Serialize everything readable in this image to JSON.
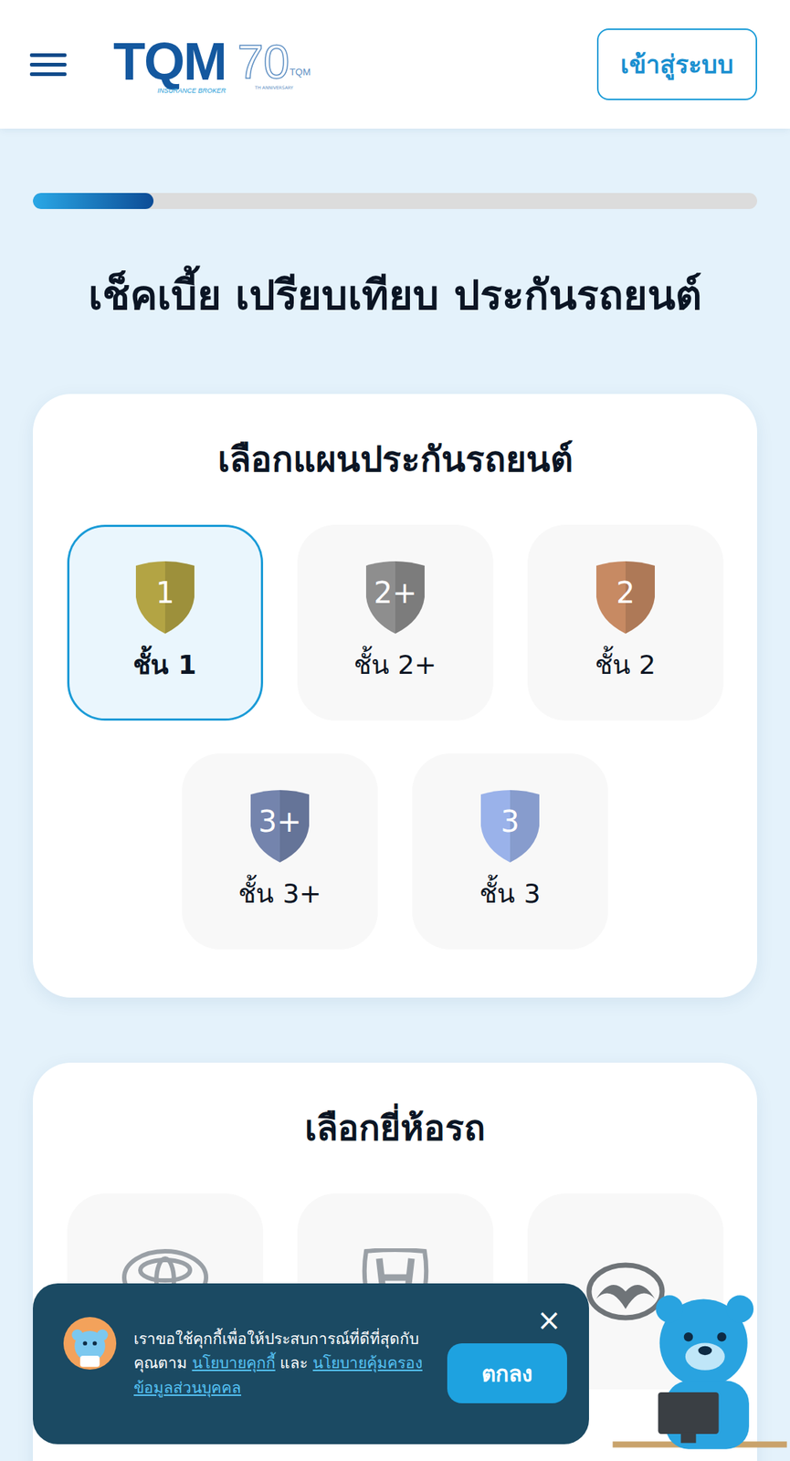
{
  "header": {
    "logo": {
      "brand": "TQM",
      "tagline": "INSURANCE BROKER",
      "anniversary": "70",
      "anniversary_brand": "TQM",
      "anniversary_caption": "TH ANNIVERSARY"
    },
    "login_button": "เข้าสู่ระบบ"
  },
  "progress": {
    "level": 0.166
  },
  "title": "เช็คเบี้ย เปรียบเทียบ ประกันรถยนต์",
  "plan_card": {
    "title": "เลือกแผนประกันรถยนต์",
    "plans": [
      {
        "badge": "1",
        "label": "ชั้น 1",
        "selected": true,
        "color": "#b3a444"
      },
      {
        "badge": "2+",
        "label": "ชั้น 2+",
        "selected": false,
        "color": "#8e8e8e"
      },
      {
        "badge": "2",
        "label": "ชั้น 2",
        "selected": false,
        "color": "#c78a63"
      },
      {
        "badge": "3+",
        "label": "ชั้น 3+",
        "selected": false,
        "color": "#7484ad"
      },
      {
        "badge": "3",
        "label": "ชั้น 3",
        "selected": false,
        "color": "#9ab2ea"
      }
    ]
  },
  "brand_card": {
    "title": "เลือกยี่ห้อรถ",
    "brands": [
      {
        "kind": "toyota",
        "label": "TOYOTA"
      },
      {
        "kind": "honda",
        "label": "HONDA"
      },
      {
        "kind": "mazda",
        "label": ""
      }
    ]
  },
  "cookie_banner": {
    "text": "เราขอใช้คุกกี้เพื่อให้ประสบการณ์ที่ดีที่สุดกับคุณตาม",
    "cookie_link": "นโยบายคุกกี้",
    "conjunction": "และ",
    "privacy_link": "นโยบายคุ้มครองข้อมูลส่วนบุคคล",
    "close": "×",
    "accept_button": "ตกลง"
  }
}
